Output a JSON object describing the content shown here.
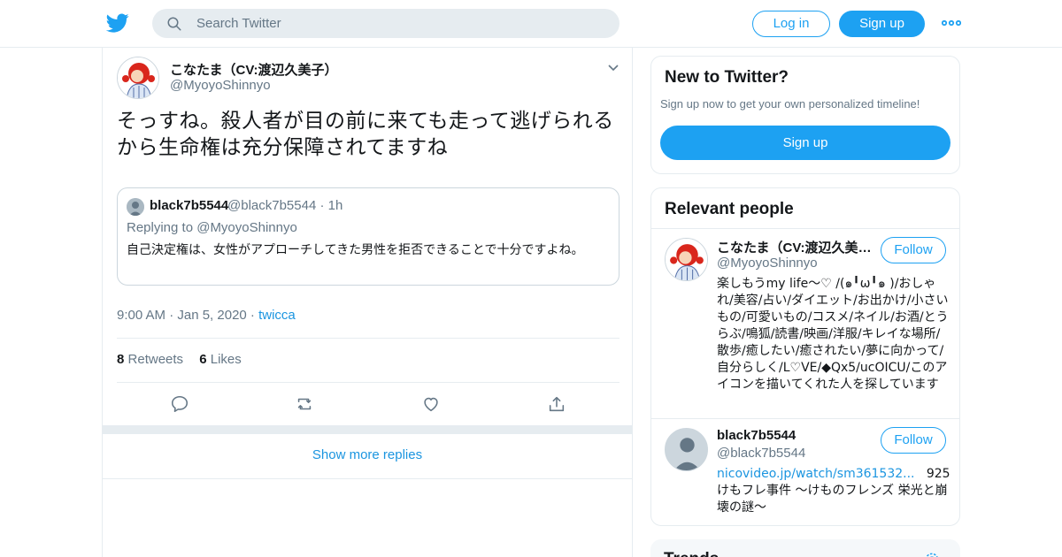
{
  "header": {
    "search_placeholder": "Search Twitter",
    "login_label": "Log in",
    "signup_label": "Sign up",
    "more_icon": "more-dots-icon",
    "logo_icon": "twitter-bird-icon",
    "accent": "#1da1f2"
  },
  "tweet": {
    "author_name": "こなたま（CV:渡辺久美子）",
    "author_handle": "@MyoyoShinnyo",
    "text": "そっすね。殺人者が目の前に来ても走って逃げられるから生命権は充分保障されてますね",
    "quote": {
      "name": "black7b5544",
      "handle_time": "@black7b5544 · 1h",
      "replying": "Replying to @MyoyoShinnyo",
      "text": "自己決定権は、女性がアプローチしてきた男性を拒否できることで十分ですよね。"
    },
    "time_date": "9:00 AM · Jan 5, 2020 · ",
    "source": "twicca",
    "retweets_count": "8",
    "retweets_label": "Retweets",
    "likes_count": "6",
    "likes_label": "Likes",
    "show_more": "Show more replies"
  },
  "sidebar": {
    "new_title": "New to Twitter?",
    "new_sub": "Sign up now to get your own personalized timeline!",
    "new_signup": "Sign up",
    "relevant_title": "Relevant people",
    "people": [
      {
        "name": "こなたま（CV:渡辺久美子）",
        "handle": "@MyoyoShinnyo",
        "follow": "Follow",
        "bio": "楽しもうmy life〜♡ /(๑╹ω╹๑ )/おしゃれ/美容/占い/ダイエット/お出かけ/小さいもの/可愛いもの/コスメ/ネイル/お酒/とうらぶ/鳴狐/読書/映画/洋服/キレイな場所/散歩/癒したい/癒されたい/夢に向かって/自分らしく/L♡VE/◆Qx5/ucOICU/このアイコンを描いてくれた人を探しています"
      },
      {
        "name": "black7b5544",
        "handle": "@black7b5544",
        "follow": "Follow",
        "bio_link": "nicovideo.jp/watch/sm361532...",
        "bio": "925けもフレ事件 ～けものフレンズ 栄光と崩壊の謎～"
      }
    ],
    "trends_title": "Trends"
  }
}
